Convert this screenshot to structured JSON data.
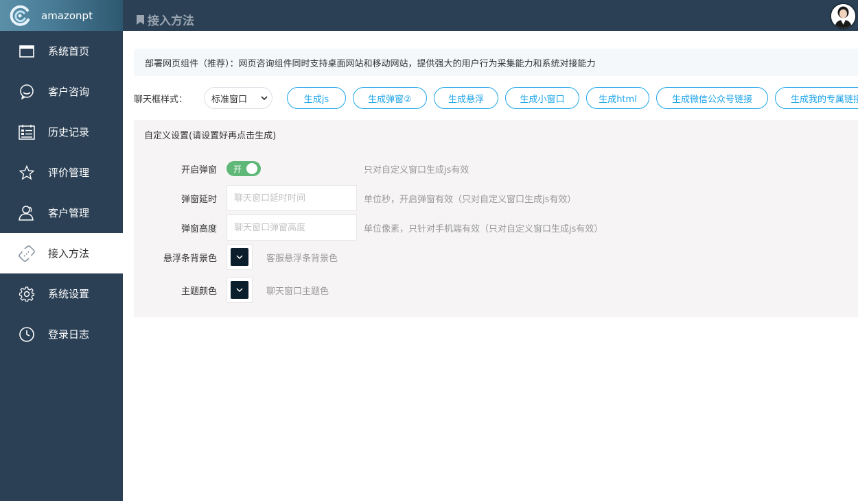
{
  "app": {
    "name": "amazonpt"
  },
  "header": {
    "title": "接入方法"
  },
  "sidebar": {
    "items": [
      {
        "label": "系统首页",
        "icon": "browser-window-icon",
        "active": false
      },
      {
        "label": "客户咨询",
        "icon": "chat-bubble-icon",
        "active": false
      },
      {
        "label": "历史记录",
        "icon": "history-list-icon",
        "active": false
      },
      {
        "label": "评价管理",
        "icon": "star-icon",
        "active": false
      },
      {
        "label": "客户管理",
        "icon": "users-icon",
        "active": false
      },
      {
        "label": "接入方法",
        "icon": "link-icon",
        "active": true
      },
      {
        "label": "系统设置",
        "icon": "gear-icon",
        "active": false
      },
      {
        "label": "登录日志",
        "icon": "clock-icon",
        "active": false
      }
    ]
  },
  "main": {
    "tip": "部署网页组件（推荐）：网页咨询组件同时支持桌面网站和移动网站，提供强大的用户行为采集能力和系统对接能力",
    "style_label": "聊天框样式：",
    "style_select": "标准窗口",
    "buttons": [
      "生成js",
      "生成弹窗②",
      "生成悬浮",
      "生成小窗口",
      "生成html",
      "生成微信公众号链接",
      "生成我的专属链接"
    ],
    "panel": {
      "title": "自定义设置(请设置好再点击生成)",
      "popup": {
        "label": "开启弹窗",
        "toggle_text": "开",
        "hint": "只对自定义窗口生成js有效"
      },
      "delay": {
        "label": "弹窗延时",
        "placeholder": "聊天窗口延时时间",
        "hint": "单位秒，开启弹窗有效（只对自定义窗口生成js有效）"
      },
      "height": {
        "label": "弹窗高度",
        "placeholder": "聊天窗口弹窗高度",
        "hint": "单位像素，只针对手机端有效（只对自定义窗口生成js有效）"
      },
      "float_color": {
        "label": "悬浮条背景色",
        "hint": "客服悬浮条背景色",
        "color": "#0b1e2b"
      },
      "theme_color": {
        "label": "主题颜色",
        "hint": "聊天窗口主题色",
        "color": "#0b1e2b"
      }
    }
  },
  "colors": {
    "sidebar_bg": "#2b4055",
    "accent": "#1aa3e8",
    "toggle_on": "#5fb878"
  }
}
